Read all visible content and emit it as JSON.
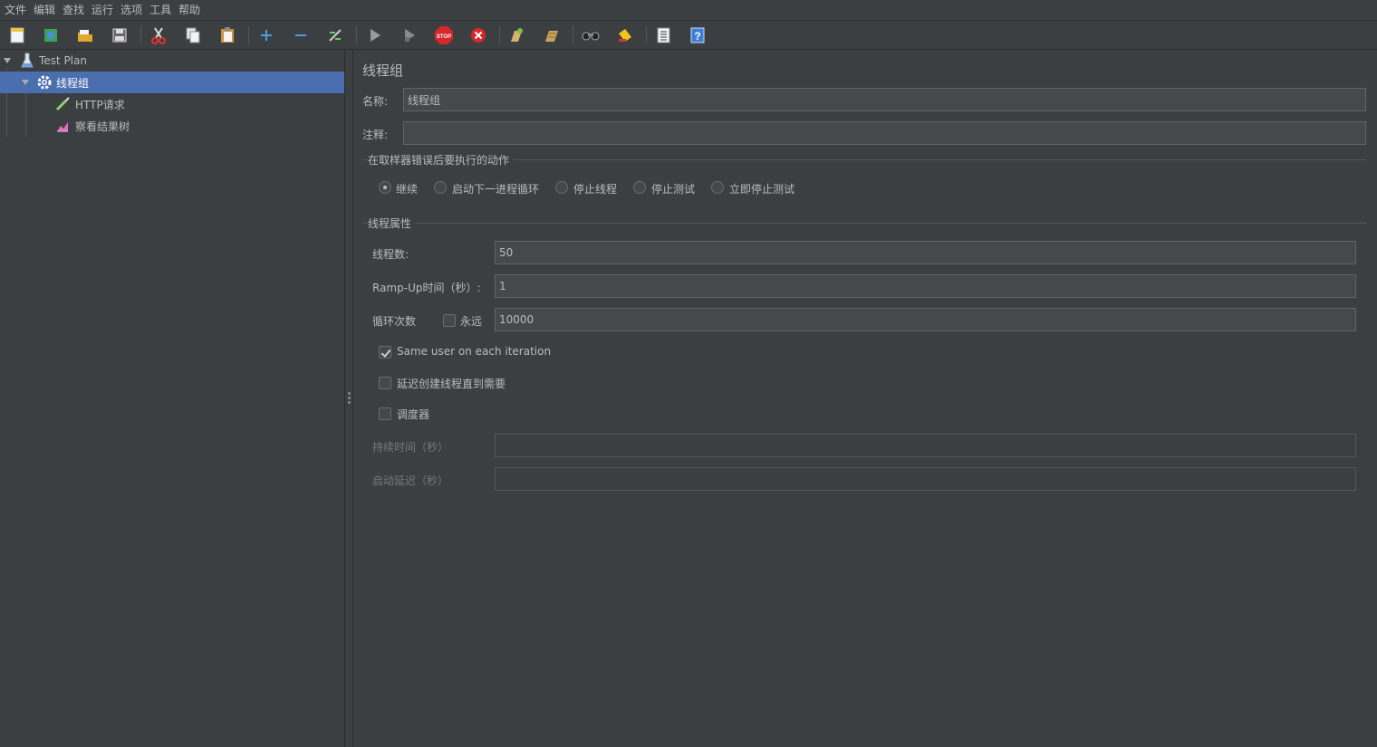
{
  "menu": [
    "文件",
    "编辑",
    "查找",
    "运行",
    "选项",
    "工具",
    "帮助"
  ],
  "toolbar": {
    "icons": [
      "new-file-icon",
      "templates-icon",
      "open-icon",
      "save-icon",
      "cut-icon",
      "copy-icon",
      "paste-icon",
      "expand-icon",
      "collapse-icon",
      "toggle-icon",
      "start-icon",
      "start-no-pause-icon",
      "stop-icon",
      "shutdown-icon",
      "clear-icon",
      "clear-all-icon",
      "search-icon",
      "reset-search-icon",
      "function-helper-icon",
      "help-icon"
    ]
  },
  "tree": {
    "root": "Test Plan",
    "thread_group": "线程组",
    "http_request": "HTTP请求",
    "result_tree": "察看结果树"
  },
  "panel": {
    "title": "线程组",
    "name_label": "名称:",
    "name_value": "线程组",
    "comment_label": "注释:",
    "comment_value": "",
    "error_group_title": "在取样器错误后要执行的动作",
    "error_actions": [
      "继续",
      "启动下一进程循环",
      "停止线程",
      "停止测试",
      "立即停止测试"
    ],
    "error_selected": "继续",
    "thread_props_title": "线程属性",
    "threads_label": "线程数:",
    "threads_value": "50",
    "rampup_label": "Ramp-Up时间（秒）:",
    "rampup_value": "1",
    "loop_label": "循环次数",
    "forever_label": "永远",
    "forever_checked": false,
    "loop_value": "10000",
    "same_user_label": "Same user on each iteration",
    "same_user_checked": true,
    "delay_create_label": "延迟创建线程直到需要",
    "delay_create_checked": false,
    "scheduler_label": "调度器",
    "scheduler_checked": false,
    "duration_label": "持续时间（秒）",
    "duration_value": "",
    "startup_delay_label": "启动延迟（秒）",
    "startup_delay_value": ""
  }
}
